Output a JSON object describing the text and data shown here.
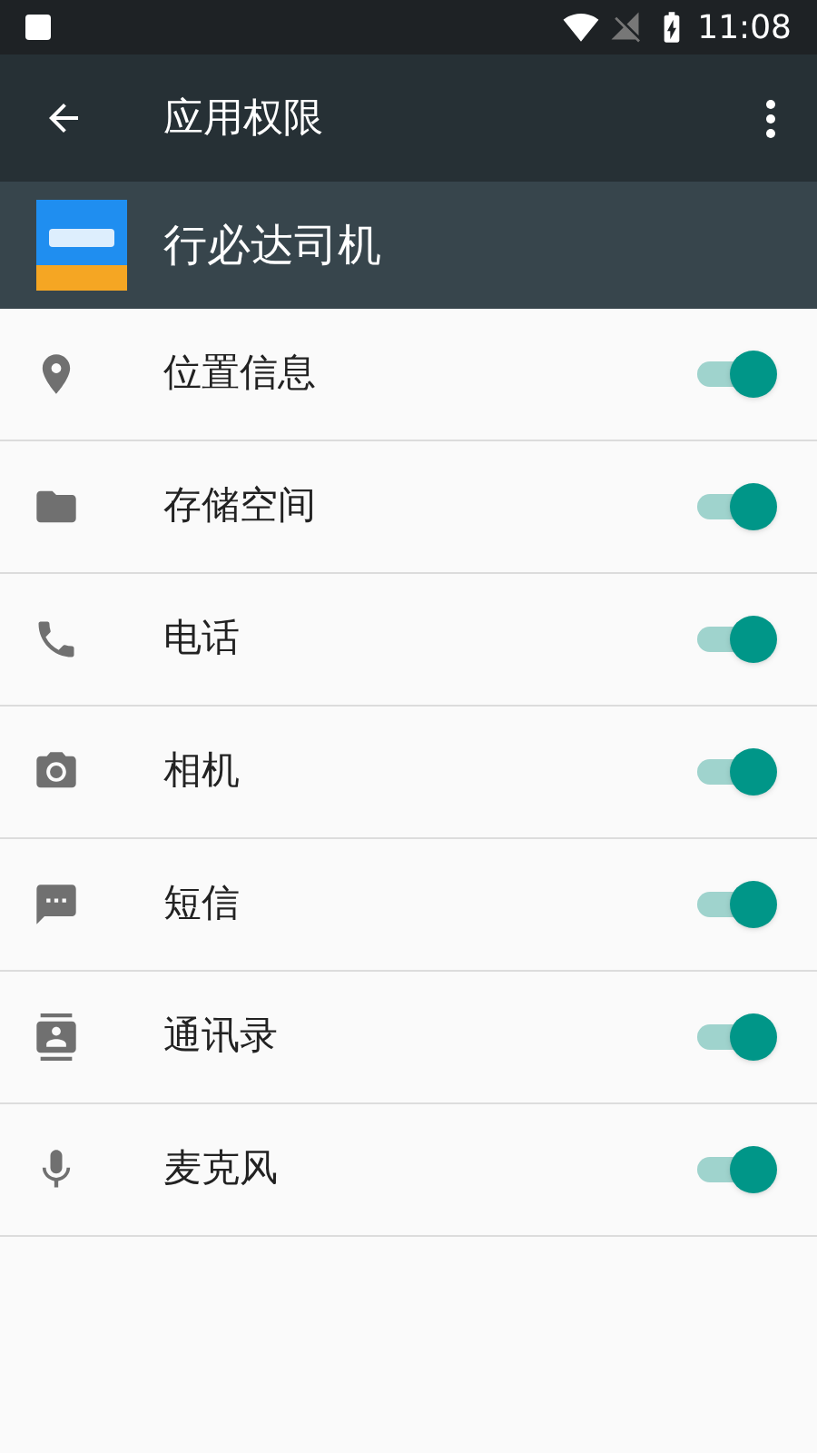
{
  "status_bar": {
    "time": "11:08"
  },
  "toolbar": {
    "title": "应用权限"
  },
  "app": {
    "name": "行必达司机"
  },
  "permissions": [
    {
      "kind": "location",
      "label": "位置信息",
      "on": true
    },
    {
      "kind": "storage",
      "label": "存储空间",
      "on": true
    },
    {
      "kind": "phone",
      "label": "电话",
      "on": true
    },
    {
      "kind": "camera",
      "label": "相机",
      "on": true
    },
    {
      "kind": "sms",
      "label": "短信",
      "on": true
    },
    {
      "kind": "contacts",
      "label": "通讯录",
      "on": true
    },
    {
      "kind": "microphone",
      "label": "麦克风",
      "on": true
    }
  ]
}
